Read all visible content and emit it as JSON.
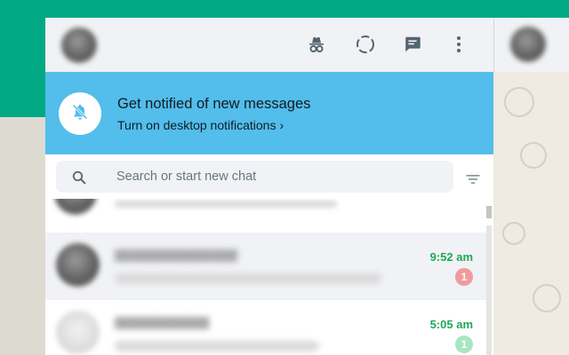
{
  "colors": {
    "brand_green": "#00a884",
    "banner_blue": "#53bdeb",
    "time_green": "#1fa855",
    "panel_gray": "#f0f2f5",
    "text_dark": "#111b21",
    "icon_gray": "#54656f"
  },
  "header": {
    "icons": [
      "incognito-icon",
      "status-icon",
      "new-chat-icon",
      "menu-icon"
    ]
  },
  "notification": {
    "title": "Get notified of new messages",
    "subtitle": "Turn on desktop notifications",
    "chevron": "›",
    "icon": "bell-muted-icon"
  },
  "search": {
    "placeholder": "Search or start new chat",
    "icon": "search-icon",
    "filter_icon": "filter-icon"
  },
  "chats": [
    {
      "time": "9:52 am",
      "unread": "1",
      "badge_color": "#f09a9f",
      "active": true
    },
    {
      "time": "5:05 am",
      "unread": "1",
      "badge_color": "#a8e6c3",
      "active": false
    }
  ]
}
